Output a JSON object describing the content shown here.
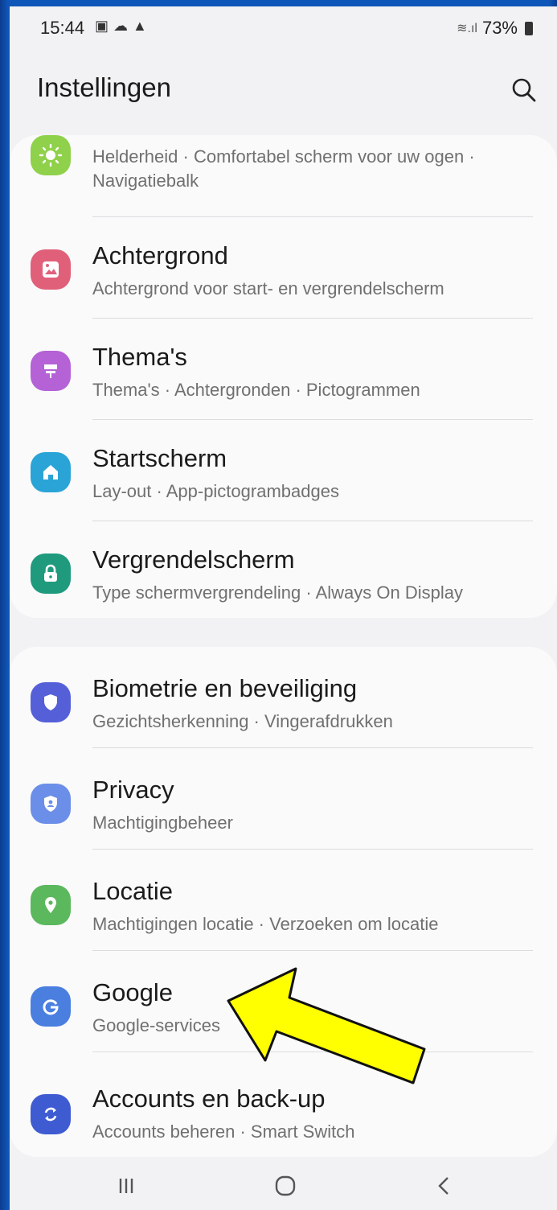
{
  "status": {
    "time": "15:44",
    "notification_icons": [
      "image-icon",
      "weather-icon",
      "cloud-icon"
    ],
    "battery": "73%"
  },
  "header": {
    "title": "Instellingen"
  },
  "group1": [
    {
      "subtitle": "Helderheid  ·  Comfortabel scherm voor uw ogen  ·",
      "subtitle2": "Navigatiebalk",
      "icon": "display-icon",
      "color": "#8fd14a"
    },
    {
      "title": "Achtergrond",
      "subtitle": "Achtergrond voor start- en vergrendelscherm",
      "icon": "wallpaper-icon",
      "color": "#e0607a"
    },
    {
      "title": "Thema's",
      "subtitle": "Thema's  ·  Achtergronden  ·  Pictogrammen",
      "icon": "themes-icon",
      "color": "#b462d6"
    },
    {
      "title": "Startscherm",
      "subtitle": "Lay-out  ·  App-pictogrambadges",
      "icon": "home-icon",
      "color": "#2aa4d6"
    },
    {
      "title": "Vergrendelscherm",
      "subtitle": "Type schermvergrendeling  ·  Always On Display",
      "icon": "lock-icon",
      "color": "#1f9a7d"
    }
  ],
  "group2": [
    {
      "title": "Biometrie en beveiliging",
      "subtitle": "Gezichtsherkenning  ·  Vingerafdrukken",
      "icon": "shield-icon",
      "color": "#5560d8"
    },
    {
      "title": "Privacy",
      "subtitle": "Machtigingbeheer",
      "icon": "privacy-icon",
      "color": "#6b8ee8"
    },
    {
      "title": "Locatie",
      "subtitle": "Machtigingen locatie  ·  Verzoeken om locatie",
      "icon": "location-icon",
      "color": "#5cb85c"
    },
    {
      "title": "Google",
      "subtitle": "Google-services",
      "icon": "google-icon",
      "color": "#4a7fe0"
    },
    {
      "title": "Accounts en back-up",
      "subtitle": "Accounts beheren  ·  Smart Switch",
      "icon": "sync-icon",
      "color": "#3f5bd1"
    }
  ],
  "annotation": {
    "arrow_color": "#ffff00",
    "target": "Google"
  }
}
